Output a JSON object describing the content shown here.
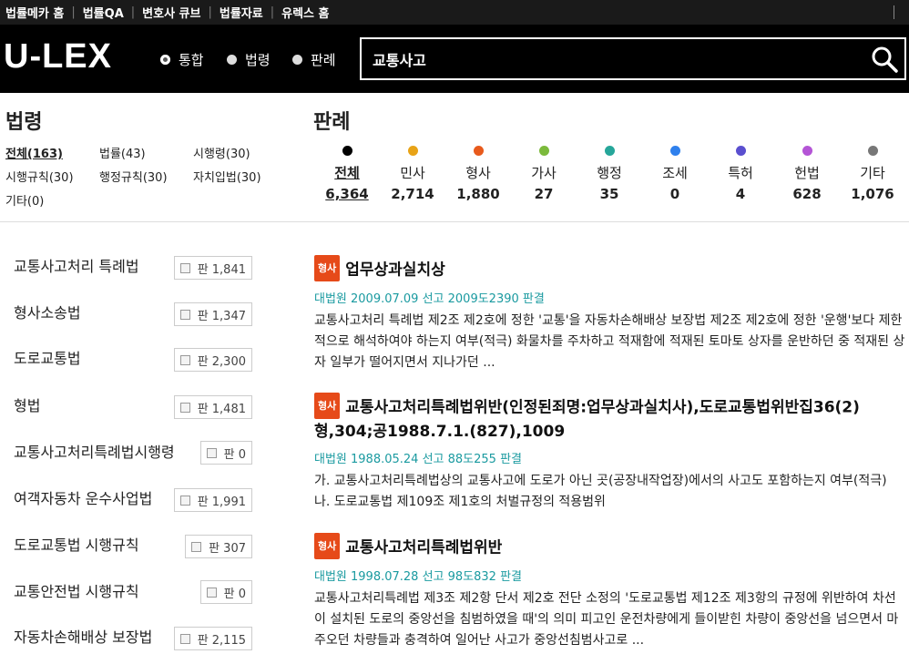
{
  "topnav": [
    "법률메카 홈",
    "법률QA",
    "변호사 큐브",
    "법률자료",
    "유렉스 홈"
  ],
  "header": {
    "logo": "U-LEX",
    "search_modes": [
      "통합",
      "법령",
      "판례"
    ],
    "selected_mode": 0,
    "search_value": "교통사고"
  },
  "law_section": {
    "title": "법령",
    "filters": [
      {
        "label": "전체",
        "count": "(163)"
      },
      {
        "label": "법률",
        "count": "(43)"
      },
      {
        "label": "시행령",
        "count": "(30)"
      },
      {
        "label": "시행규칙",
        "count": "(30)"
      },
      {
        "label": "행정규칙",
        "count": "(30)"
      },
      {
        "label": "자치입법",
        "count": "(30)"
      },
      {
        "label": "기타",
        "count": "(0)"
      }
    ]
  },
  "case_section": {
    "title": "판례",
    "categories": [
      {
        "label": "전체",
        "count": "6,364",
        "color": "#000000"
      },
      {
        "label": "민사",
        "count": "2,714",
        "color": "#e8a317"
      },
      {
        "label": "형사",
        "count": "1,880",
        "color": "#e85a1c"
      },
      {
        "label": "가사",
        "count": "27",
        "color": "#7cba3c"
      },
      {
        "label": "행정",
        "count": "35",
        "color": "#26a69a"
      },
      {
        "label": "조세",
        "count": "0",
        "color": "#2f80ed"
      },
      {
        "label": "특허",
        "count": "4",
        "color": "#5a4fcf"
      },
      {
        "label": "헌법",
        "count": "628",
        "color": "#b455d6"
      },
      {
        "label": "기타",
        "count": "1,076",
        "color": "#777777"
      }
    ]
  },
  "law_list": [
    {
      "name": "교통사고처리 특례법",
      "badge": "판 1,841"
    },
    {
      "name": "형사소송법",
      "badge": "판 1,347"
    },
    {
      "name": "도로교통법",
      "badge": "판 2,300"
    },
    {
      "name": "형법",
      "badge": "판 1,481"
    },
    {
      "name": "교통사고처리특례법시행령",
      "badge": "판 0"
    },
    {
      "name": "여객자동차 운수사업법",
      "badge": "판 1,991"
    },
    {
      "name": "도로교통법 시행규칙",
      "badge": "판 307"
    },
    {
      "name": "교통안전법 시행규칙",
      "badge": "판 0"
    },
    {
      "name": "자동차손해배상 보장법",
      "badge": "판 2,115"
    }
  ],
  "results": [
    {
      "tag": "형사",
      "title": "업무상과실치상",
      "meta": "대법원 2009.07.09 선고 2009도2390 판결",
      "body": "교통사고처리 특례법 제2조 제2호에 정한 '교통'을 자동차손해배상 보장법 제2조 제2호에 정한 '운행'보다 제한적으로 해석하여야 하는지 여부(적극) 화물차를 주차하고 적재함에 적재된 토마토 상자를 운반하던 중 적재된 상자 일부가 떨어지면서 지나가던 ..."
    },
    {
      "tag": "형사",
      "title": "교통사고처리특례법위반(인정된죄명:업무상과실치사),도로교통법위반집36(2)형,304;공1988.7.1.(827),1009",
      "meta": "대법원 1988.05.24 선고 88도255 판결",
      "body": "가. 교통사고처리특례법상의 교통사고에 도로가 아닌 곳(공장내작업장)에서의 사고도 포함하는지 여부(적극) 나. 도로교통법 제109조 제1호의 처벌규정의 적용범위"
    },
    {
      "tag": "형사",
      "title": "교통사고처리특례법위반",
      "meta": "대법원 1998.07.28 선고 98도832 판결",
      "body": "교통사고처리특례법 제3조 제2항 단서 제2호 전단 소정의 '도로교통법 제12조 제3항의 규정에 위반하여 차선이 설치된 도로의 중앙선을 침범하였을 때'의 의미 피고인 운전차량에게 들이받힌 차량이 중앙선을 넘으면서 마주오던 차량들과 충격하여 일어난 사고가 중앙선침범사고로 ..."
    }
  ]
}
